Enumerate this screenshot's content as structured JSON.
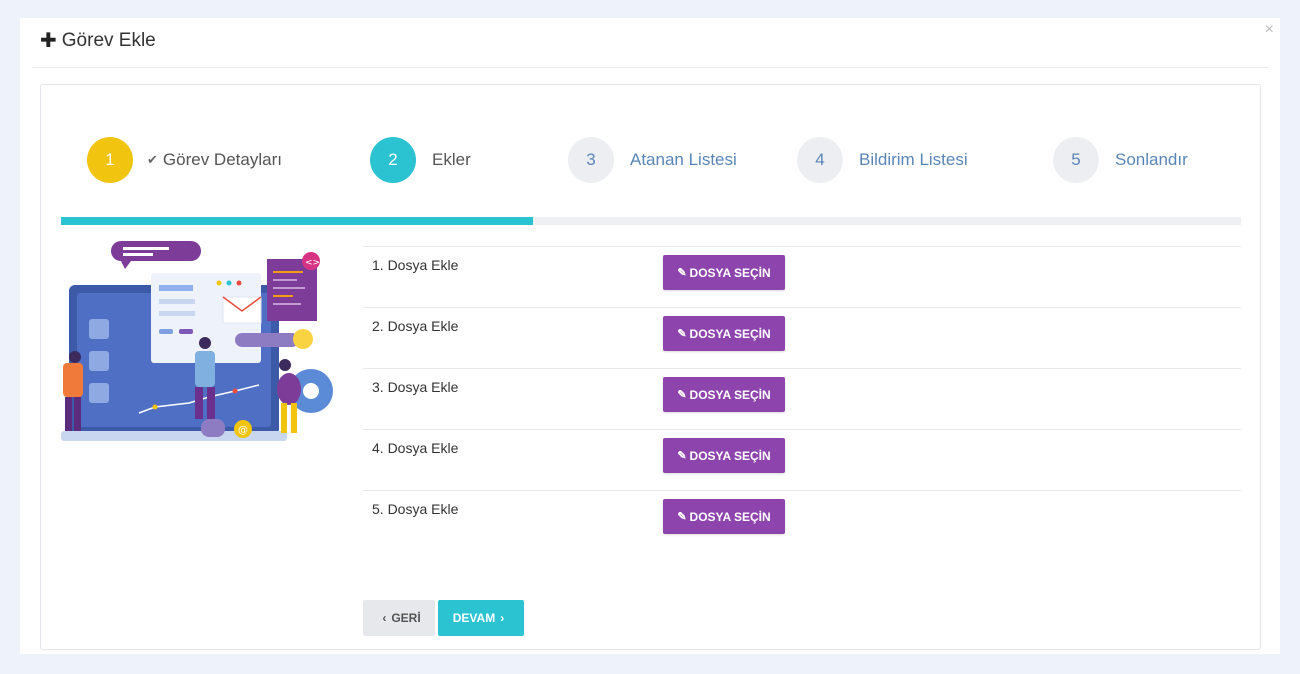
{
  "modal": {
    "title": "Görev Ekle",
    "close_symbol": "×"
  },
  "steps": [
    {
      "number": "1",
      "label": "Görev Detayları",
      "state": "completed"
    },
    {
      "number": "2",
      "label": "Ekler",
      "state": "active"
    },
    {
      "number": "3",
      "label": "Atanan Listesi",
      "state": "pending"
    },
    {
      "number": "4",
      "label": "Bildirim Listesi",
      "state": "pending"
    },
    {
      "number": "5",
      "label": "Sonlandır",
      "state": "pending"
    }
  ],
  "progress": {
    "fraction": 0.4
  },
  "attachments": [
    {
      "label": "1. Dosya Ekle",
      "button": "DOSYA SEÇİN"
    },
    {
      "label": "2. Dosya Ekle",
      "button": "DOSYA SEÇİN"
    },
    {
      "label": "3. Dosya Ekle",
      "button": "DOSYA SEÇİN"
    },
    {
      "label": "4. Dosya Ekle",
      "button": "DOSYA SEÇİN"
    },
    {
      "label": "5. Dosya Ekle",
      "button": "DOSYA SEÇİN"
    }
  ],
  "navigation": {
    "back_label": "GERİ",
    "next_label": "DEVAM"
  },
  "colors": {
    "step_completed": "#f1c40f",
    "step_active": "#2bc3d2",
    "file_button": "#8e44ad",
    "next_button": "#2bc3d2"
  },
  "icons": {
    "title": "plus-icon",
    "close": "close-icon",
    "completed_step": "check-icon",
    "file_button": "paperclip-icon",
    "back": "chevron-left-icon",
    "next": "chevron-right-icon"
  }
}
